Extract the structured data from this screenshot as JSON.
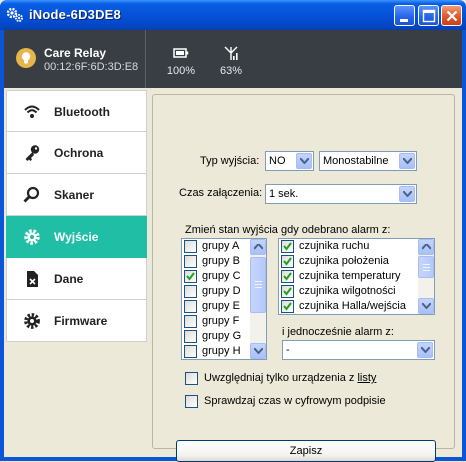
{
  "window": {
    "title": "iNode-6D3DE8"
  },
  "header": {
    "device_name": "Care Relay",
    "device_mac": "00:12:6F:6D:3D:E8",
    "battery": "100%",
    "signal": "63%"
  },
  "sidebar": {
    "items": [
      {
        "label": "Bluetooth",
        "icon": "wifi-icon"
      },
      {
        "label": "Ochrona",
        "icon": "key-icon"
      },
      {
        "label": "Skaner",
        "icon": "search-icon"
      },
      {
        "label": "Wyjście",
        "icon": "gear-icon",
        "active": true
      },
      {
        "label": "Dane",
        "icon": "file-icon"
      },
      {
        "label": "Firmware",
        "icon": "cog-icon"
      }
    ],
    "active_color": "#1fbea5"
  },
  "form": {
    "output_type_label": "Typ wyjścia:",
    "output_mode": "NO",
    "output_behavior": "Monostabilne",
    "on_time_label": "Czas załączenia:",
    "on_time": "1 sek.",
    "alarm_group_label": "Zmień stan wyjścia gdy odebrano alarm z:",
    "groups": [
      {
        "label": "grupy A",
        "checked": false
      },
      {
        "label": "grupy B",
        "checked": false
      },
      {
        "label": "grupy C",
        "checked": true
      },
      {
        "label": "grupy D",
        "checked": false
      },
      {
        "label": "grupy E",
        "checked": false
      },
      {
        "label": "grupy F",
        "checked": false
      },
      {
        "label": "grupy G",
        "checked": false
      },
      {
        "label": "grupy H",
        "checked": false
      }
    ],
    "sensors": [
      {
        "label": "czujnika ruchu",
        "checked": true
      },
      {
        "label": "czujnika położenia",
        "checked": true
      },
      {
        "label": "czujnika temperatury",
        "checked": true
      },
      {
        "label": "czujnika wilgotności",
        "checked": true
      },
      {
        "label": "czujnika Halla/wejścia",
        "checked": true
      }
    ],
    "and_alarm_label": "i jednocześnie alarm z:",
    "and_alarm_value": "-",
    "list_option_prefix": "Uwzględniaj tylko urządzenia z ",
    "list_option_link": "listy",
    "list_option_checked": false,
    "signature_option": "Sprawdzaj czas w cyfrowym podpisie",
    "signature_option_checked": false,
    "save_label": "Zapisz"
  }
}
